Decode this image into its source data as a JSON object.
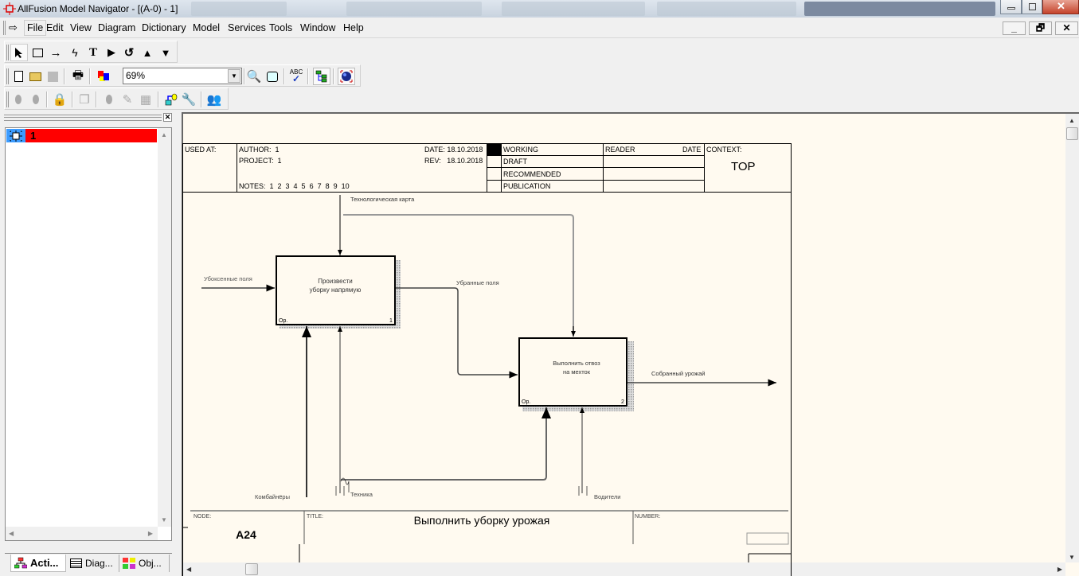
{
  "window": {
    "title": "AllFusion Model Navigator - [(A-0)  - 1]",
    "controls": {
      "minimize": "_",
      "restore": "🗗",
      "close": "✕"
    }
  },
  "menubar": {
    "items": [
      {
        "label": "File",
        "accel": "F"
      },
      {
        "label": "Edit",
        "accel": "E"
      },
      {
        "label": "View",
        "accel": "V"
      },
      {
        "label": "Diagram",
        "accel": "D"
      },
      {
        "label": "Dictionary",
        "accel": "c"
      },
      {
        "label": "Model",
        "accel": "o"
      },
      {
        "label": "Services",
        "accel": "S"
      },
      {
        "label": "Tools",
        "accel": "T"
      },
      {
        "label": "Window",
        "accel": "W"
      },
      {
        "label": "Help",
        "accel": "H"
      }
    ],
    "mdi": {
      "minimize": "_",
      "restore": "🗗",
      "close": "✕"
    }
  },
  "toolbars": {
    "drawing": [
      "pointer-tool",
      "box-tool",
      "arrow-tool",
      "squiggle-tool",
      "text-tool",
      "go-to-sibling-tool",
      "go-to-parent-tool",
      "go-up-tool",
      "go-down-tool"
    ],
    "standard": {
      "zoom_value": "69%"
    }
  },
  "left_pane": {
    "tree_items": [
      {
        "label": "1"
      }
    ],
    "tabs": [
      {
        "label": "Acti...",
        "active": true
      },
      {
        "label": "Diag...",
        "active": false
      },
      {
        "label": "Obj...",
        "active": false
      }
    ]
  },
  "diagram": {
    "header": {
      "used_at": "USED AT:",
      "author_label": "AUTHOR:",
      "author": "1",
      "project_label": "PROJECT:",
      "project": "1",
      "date_label": "DATE:",
      "date": "18.10.2018",
      "rev_label": "REV:",
      "rev": "18.10.2018",
      "notes_label": "NOTES:",
      "notes": "1  2  3  4  5  6  7  8  9  10",
      "status": [
        "WORKING",
        "DRAFT",
        "RECOMMENDED",
        "PUBLICATION"
      ],
      "reader_label": "READER",
      "reader_date_label": "DATE",
      "context_label": "CONTEXT:",
      "context": "TOP"
    },
    "boxes": [
      {
        "text_line1": "Произвести",
        "text_line2": "уборку напрямую",
        "op": "Op.",
        "number": "1"
      },
      {
        "text_line1": "Выполнить отвоз",
        "text_line2": "на мехток",
        "op": "Op.",
        "number": "2"
      }
    ],
    "arrows": {
      "control": "Технологическая карта",
      "input": "Убоксенные поля",
      "between": "Убранные поля",
      "output": "Собранный урожай",
      "mech1": "Комбайнёры",
      "mech2": "Техника",
      "mech3": "Водители"
    },
    "footer": {
      "node_label": "NODE:",
      "node": "A24",
      "title_label": "TITLE:",
      "title": "Выполнить уборку урожая",
      "number_label": "NUMBER:"
    }
  },
  "colors": {
    "canvas_bg": "#fffaf0",
    "tree_selected_bg": "#ff0000",
    "tree_icon_bg": "#3c9cff"
  }
}
